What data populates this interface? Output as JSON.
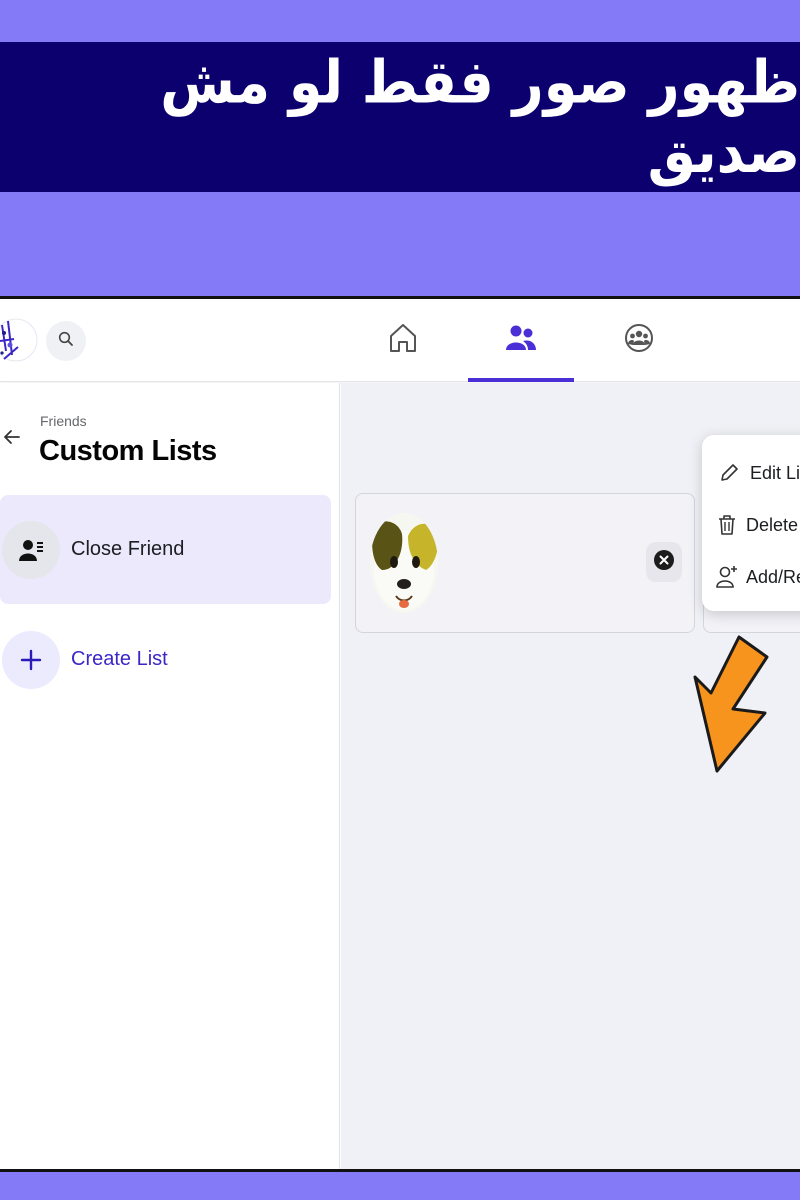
{
  "banner": {
    "title": "ظهور صور فقط لو مش صديق"
  },
  "topbar": {
    "logo_icon": "abstract-logo",
    "search_icon": "search-icon",
    "tabs": [
      {
        "name": "home",
        "icon": "home-icon",
        "active": false
      },
      {
        "name": "friends",
        "icon": "friends-icon",
        "active": true
      },
      {
        "name": "groups",
        "icon": "groups-icon",
        "active": false
      }
    ]
  },
  "sidebar": {
    "breadcrumb": "Friends",
    "title": "Custom Lists",
    "items": [
      {
        "label": "Close Friend",
        "icon": "contact-list-icon",
        "selected": true
      },
      {
        "label": "Create List",
        "icon": "plus-icon",
        "selected": false
      }
    ]
  },
  "main": {
    "card": {
      "avatar": "dog-emoji-avatar",
      "remove_icon": "close-circle-icon"
    },
    "menu": {
      "items": [
        {
          "label": "Edit List",
          "icon": "pencil-icon"
        },
        {
          "label": "Delete List",
          "icon": "trash-icon"
        },
        {
          "label": "Add/Remove",
          "icon": "add-person-icon"
        }
      ]
    }
  },
  "colors": {
    "background": "#8479f6",
    "banner": "#0b006e",
    "accent": "#4a2fd6",
    "selected_row": "#ece9fd",
    "arrow": "#f7941d"
  }
}
